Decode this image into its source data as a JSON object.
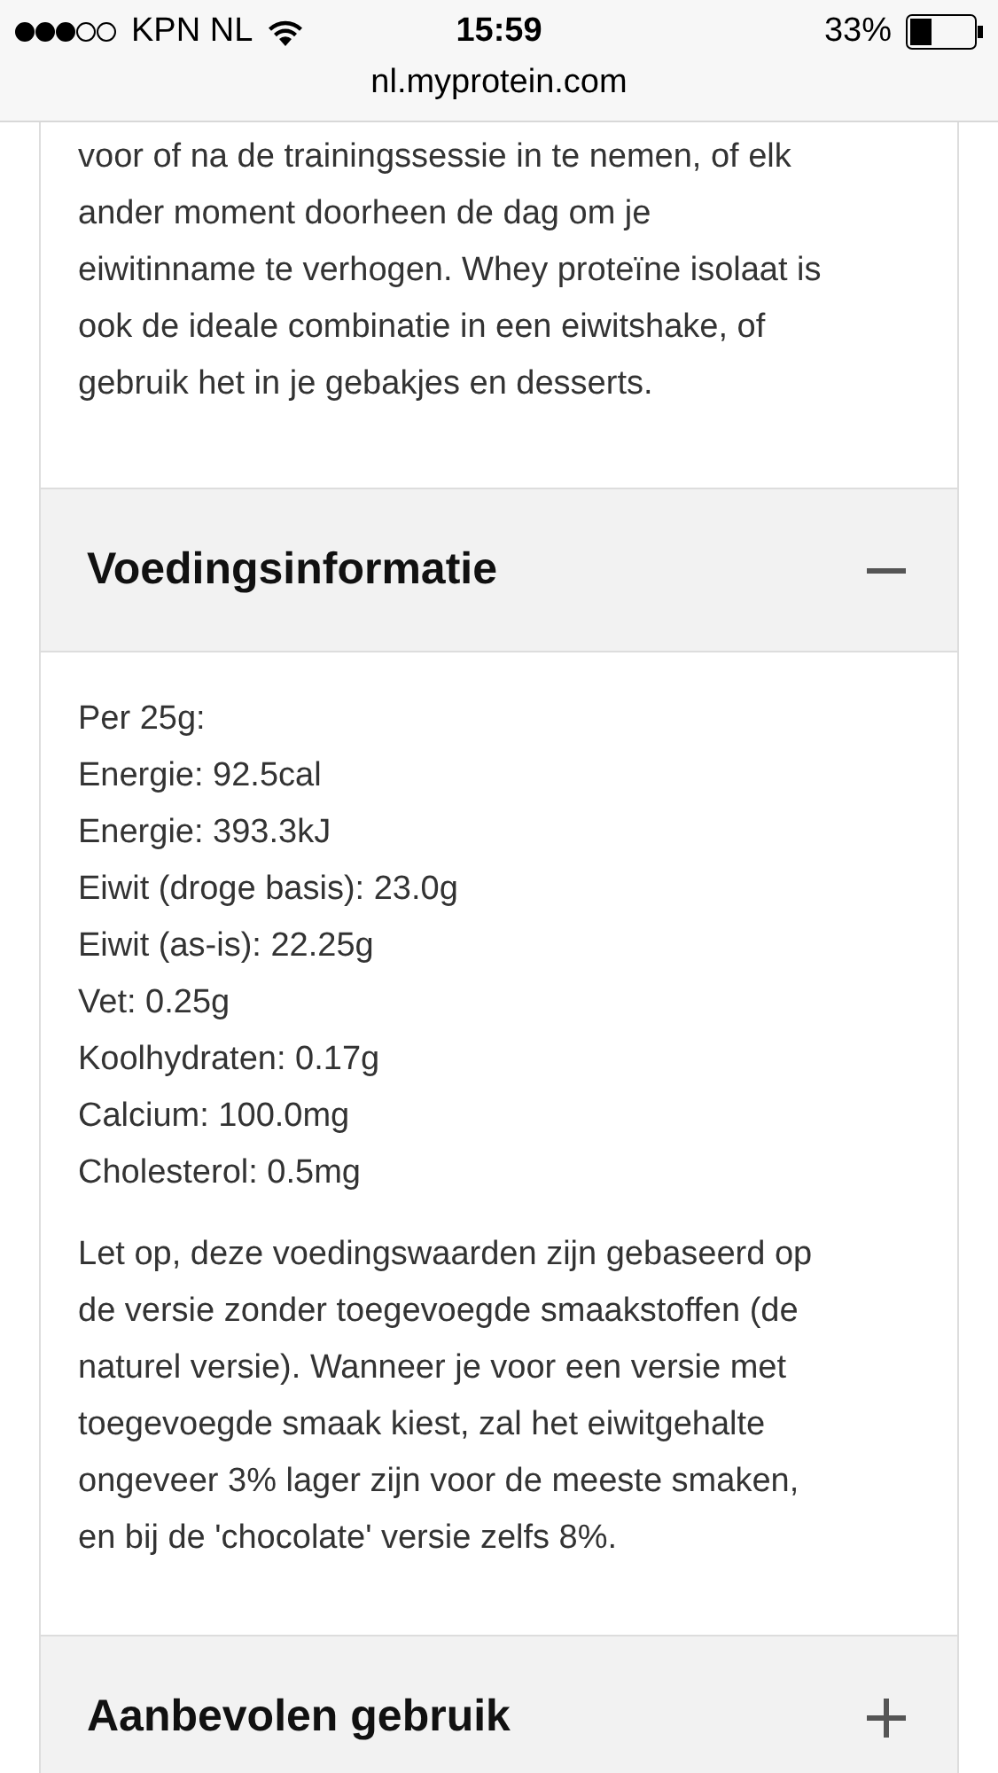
{
  "status_bar": {
    "carrier": "KPN NL",
    "time": "15:59",
    "battery": "33%",
    "url": "nl.myprotein.com"
  },
  "intro_lines": [
    "voor of na de trainingssessie in te nemen, of elk",
    "ander moment doorheen de dag om je",
    "eiwitinname te verhogen. Whey proteïne isolaat is",
    "ook de ideale combinatie in een eiwitshake, of",
    "gebruik het in je gebakjes en desserts."
  ],
  "sections": [
    {
      "title": "Voedingsinformatie",
      "expanded": true,
      "nutrition": [
        "Per 25g:",
        "Energie: 92.5cal",
        "Energie: 393.3kJ",
        "Eiwit (droge basis): 23.0g",
        "Eiwit (as-is): 22.25g",
        "Vet: 0.25g",
        "Koolhydraten: 0.17g",
        "Calcium: 100.0mg",
        "Cholesterol: 0.5mg"
      ],
      "note_lines": [
        "Let op, deze voedingswaarden zijn gebaseerd op",
        "de versie zonder toegevoegde smaakstoffen (de",
        "naturel versie). Wanneer je voor een versie met",
        "toegevoegde smaak kiest, zal het eiwitgehalte",
        "ongeveer 3% lager zijn voor de meeste smaken,",
        "en bij de 'chocolate' versie zelfs 8%."
      ]
    },
    {
      "title": "Aanbevolen gebruik",
      "expanded": false
    }
  ]
}
